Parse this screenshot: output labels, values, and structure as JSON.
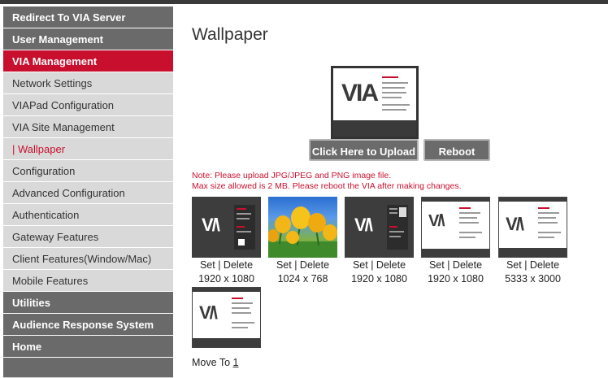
{
  "sidebar": {
    "items": [
      {
        "label": "Redirect To VIA Server",
        "style": "dark"
      },
      {
        "label": "User Management",
        "style": "dark"
      },
      {
        "label": "VIA Management",
        "style": "active"
      },
      {
        "label": "Network Settings",
        "style": "light"
      },
      {
        "label": "VIAPad Configuration",
        "style": "light"
      },
      {
        "label": "VIA Site Management",
        "style": "light"
      },
      {
        "label": "| Wallpaper",
        "style": "sub"
      },
      {
        "label": "Configuration",
        "style": "light"
      },
      {
        "label": "Advanced Configuration",
        "style": "light"
      },
      {
        "label": "Authentication",
        "style": "light"
      },
      {
        "label": "Gateway Features",
        "style": "light"
      },
      {
        "label": "Client Features(Window/Mac)",
        "style": "light"
      },
      {
        "label": "Mobile Features",
        "style": "light"
      },
      {
        "label": "Utilities",
        "style": "dark"
      },
      {
        "label": "Audience Response System",
        "style": "dark"
      },
      {
        "label": "Home",
        "style": "dark"
      }
    ]
  },
  "main": {
    "title": "Wallpaper",
    "preview_logo": "VIA",
    "upload_button": "Click Here to Upload",
    "reboot_button": "Reboot",
    "note_line1": "Note: Please upload JPG/JPEG and PNG image file.",
    "note_line2": "Max size allowed is 2 MB. Please reboot the VIA after making changes.",
    "thumbnails": [
      {
        "set": "Set",
        "sep": "|",
        "delete": "Delete",
        "size": "1920 x 1080",
        "kind": "dark-via"
      },
      {
        "set": "Set",
        "sep": "|",
        "delete": "Delete",
        "size": "1024 x 768",
        "kind": "tulips"
      },
      {
        "set": "Set",
        "sep": "|",
        "delete": "Delete",
        "size": "1920 x 1080",
        "kind": "dark-via-qr"
      },
      {
        "set": "Set",
        "sep": "|",
        "delete": "Delete",
        "size": "1920 x 1080",
        "kind": "light-via"
      },
      {
        "set": "Set",
        "sep": "|",
        "delete": "Delete",
        "size": "5333 x 3000",
        "kind": "light-via-wide"
      },
      {
        "set": "",
        "sep": "",
        "delete": "",
        "size": "",
        "kind": "light-via"
      }
    ],
    "pager_label": "Move To",
    "pager_page": "1"
  },
  "colors": {
    "accent": "#c8102e",
    "nav_dark": "#6a6a6a",
    "nav_light": "#d9d9d9",
    "button": "#6b6b6b"
  }
}
